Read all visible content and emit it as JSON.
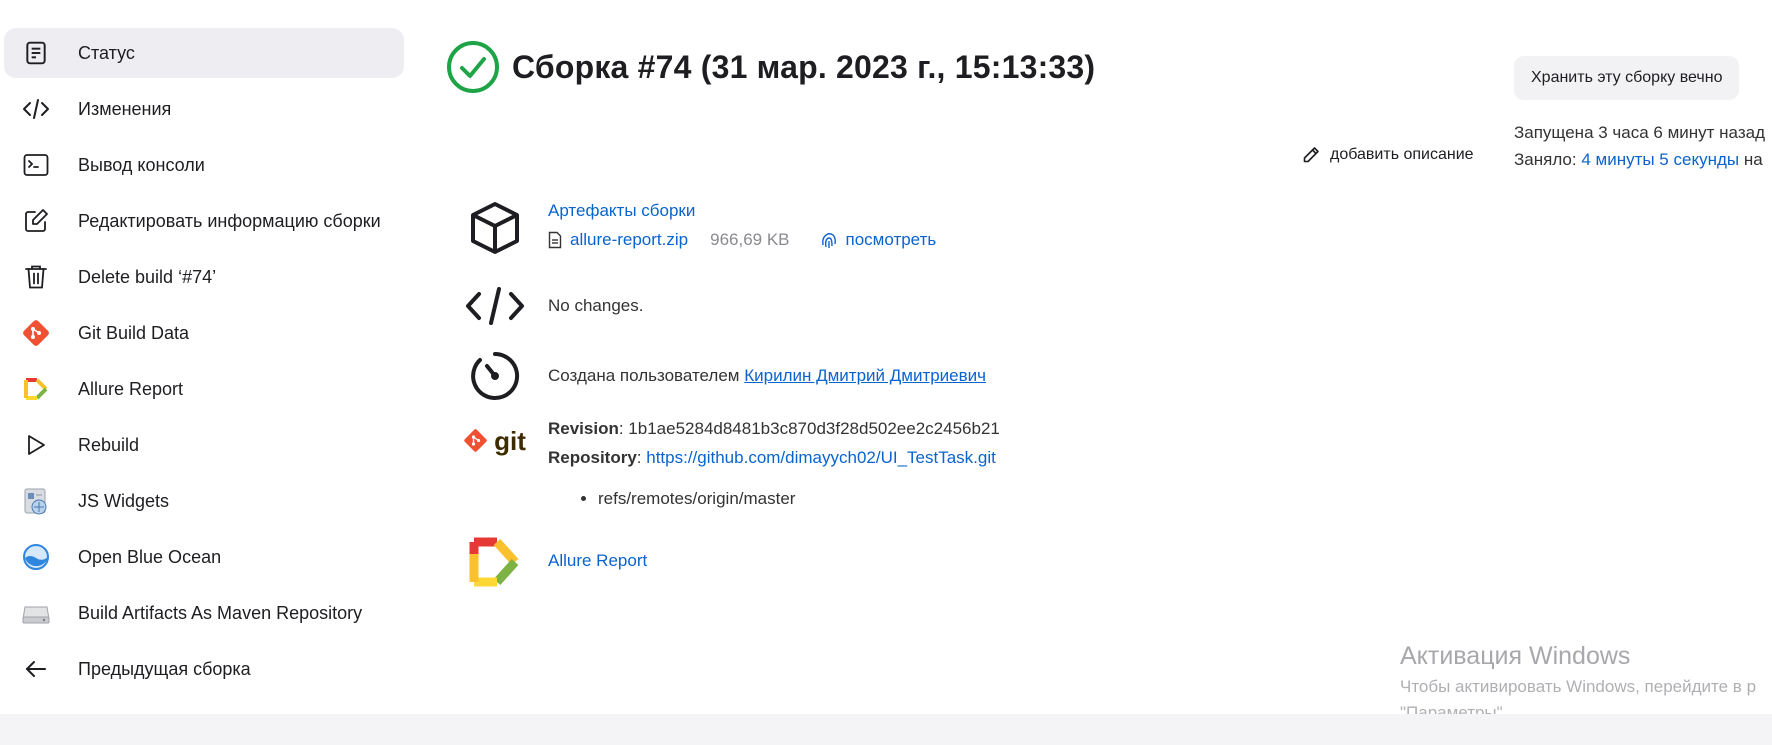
{
  "sidebar": {
    "items": [
      {
        "label": "Статус",
        "icon": "document-icon",
        "active": true
      },
      {
        "label": "Изменения",
        "icon": "code-icon"
      },
      {
        "label": "Вывод консоли",
        "icon": "terminal-icon"
      },
      {
        "label": "Редактировать информацию сборки",
        "icon": "edit-icon"
      },
      {
        "label": "Delete build ‘#74’",
        "icon": "trash-icon"
      },
      {
        "label": "Git Build Data",
        "icon": "git-icon"
      },
      {
        "label": "Allure Report",
        "icon": "allure-icon"
      },
      {
        "label": "Rebuild",
        "icon": "play-icon"
      },
      {
        "label": "JS Widgets",
        "icon": "widgets-icon"
      },
      {
        "label": "Open Blue Ocean",
        "icon": "blue-ocean-icon"
      },
      {
        "label": "Build Artifacts As Maven Repository",
        "icon": "disk-icon"
      },
      {
        "label": "Предыдущая сборка",
        "icon": "arrow-left-icon"
      }
    ]
  },
  "header": {
    "title": "Сборка #74 (31 мар. 2023 г., 15:13:33)",
    "status_icon": "success-check-icon",
    "keep_button": "Хранить эту сборку вечно",
    "started": "Запущена 3 часа 6 минут назад",
    "duration_prefix": "Заняло: ",
    "duration_link": "4 минуты 5 секунды",
    "duration_suffix": " на",
    "add_description": "добавить описание"
  },
  "artifacts": {
    "title": "Артефакты сборки",
    "file": "allure-report.zip",
    "size": "966,69 KB",
    "view": "посмотреть"
  },
  "changes": {
    "text": "No changes."
  },
  "cause": {
    "prefix": "Создана пользователем ",
    "user": "Кирилин Дмитрий Дмитриевич"
  },
  "git": {
    "logo_text": "git",
    "revision_label": "Revision",
    "revision": ": 1b1ae5284d8481b3c870d3f28d502ee2c2456b21",
    "repository_label": "Repository",
    "repository_sep": ": ",
    "repository_url": "https://github.com/dimayych02/UI_TestTask.git",
    "refs": [
      "refs/remotes/origin/master"
    ]
  },
  "allure": {
    "label": "Allure Report"
  },
  "watermark": {
    "title": "Активация Windows",
    "line1": "Чтобы активировать Windows, перейдите в р",
    "line2": "\"Параметры\"."
  },
  "colors": {
    "accent": "#0b63ce",
    "success": "#1ea446",
    "git": "#f05133"
  }
}
